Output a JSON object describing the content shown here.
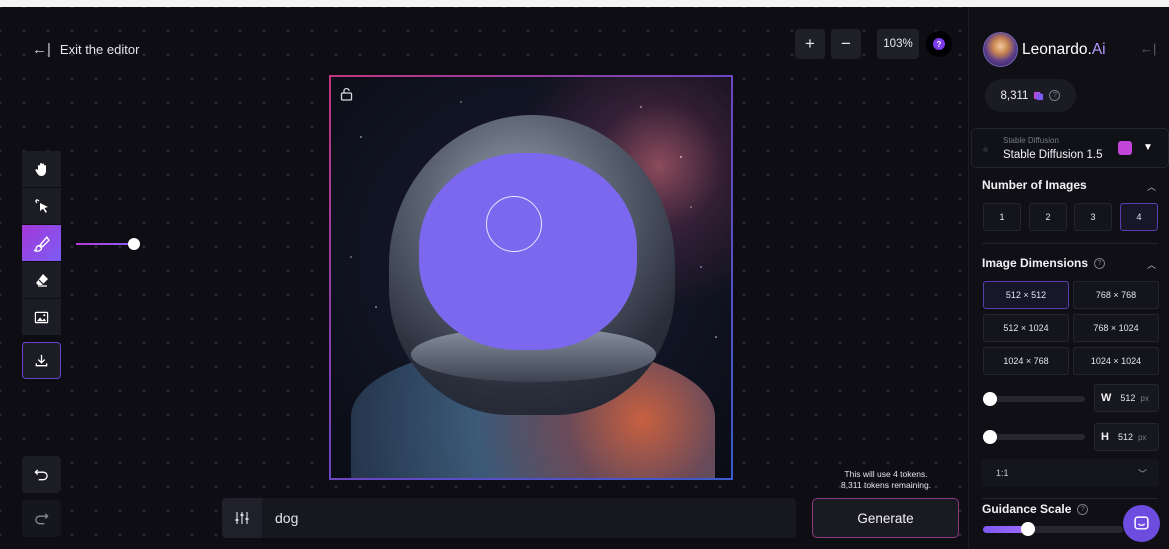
{
  "editor": {
    "exit_label": "Exit the editor",
    "zoom_in": "+",
    "zoom_out": "−",
    "zoom_level": "103%",
    "help_glyph": "?"
  },
  "toolbar": {
    "tools": [
      "hand-icon",
      "select-icon",
      "brush-icon",
      "eraser-icon",
      "image-icon"
    ],
    "active_tool": "brush-icon",
    "brush_size": 0.9,
    "download": "download-icon",
    "undo": "undo-icon",
    "redo": "redo-icon"
  },
  "canvas": {
    "mask_color": "#7B68EE"
  },
  "prompt": {
    "value": "dog",
    "settings_icon": "sliders-icon"
  },
  "generate": {
    "note_line1": "This will use 4 tokens.",
    "note_line2": "8,311 tokens remaining.",
    "label": "Generate"
  },
  "sidebar": {
    "brand_name": "Leonardo.",
    "brand_suffix": "Ai",
    "token_count": "8,311",
    "model": {
      "small_label": "Stable Diffusion",
      "name": "Stable Diffusion 1.5"
    },
    "number_of_images": {
      "title": "Number of Images",
      "options": [
        "1",
        "2",
        "3",
        "4"
      ],
      "selected": "4"
    },
    "image_dimensions": {
      "title": "Image Dimensions",
      "options": [
        "512 × 512",
        "768 × 768",
        "512 × 1024",
        "768 × 1024",
        "1024 × 768",
        "1024 × 1024"
      ],
      "selected": "512 × 512"
    },
    "width": {
      "axis": "W",
      "value": "512",
      "unit": "px",
      "level": 0
    },
    "height": {
      "axis": "H",
      "value": "512",
      "unit": "px",
      "level": 0
    },
    "aspect_ratio": "1:1",
    "guidance_scale": {
      "title": "Guidance Scale",
      "level": 0.33
    }
  },
  "colors": {
    "accent": "#7B5CF5",
    "magenta": "#C145D6",
    "background": "#0B0B10"
  }
}
